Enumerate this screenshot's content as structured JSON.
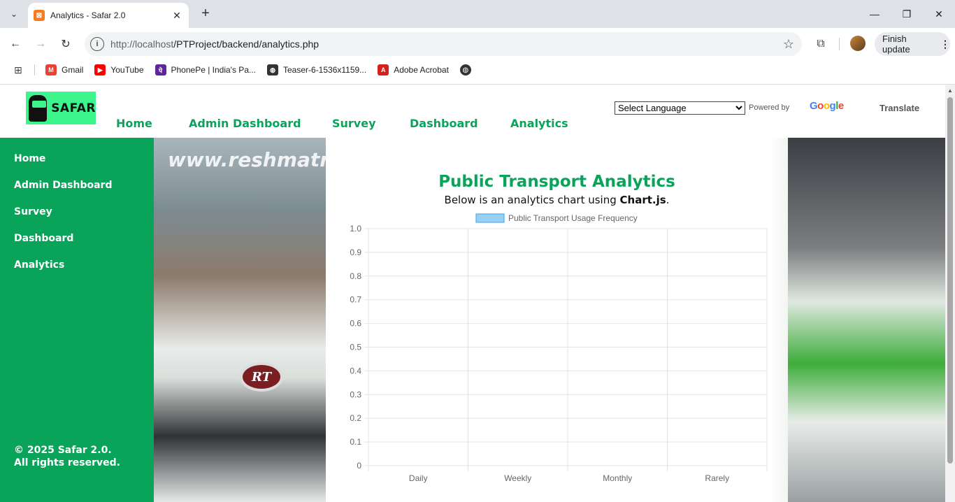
{
  "browser": {
    "tab_title": "Analytics - Safar 2.0",
    "url_host": "http://localhost",
    "url_path": "/PTProject/backend/analytics.php",
    "update_label": "Finish update",
    "bookmarks": [
      {
        "label": "Gmail",
        "color": "#ea4335",
        "glyph": "M"
      },
      {
        "label": "YouTube",
        "color": "#ff0000",
        "glyph": "▶"
      },
      {
        "label": "PhonePe | India's Pa...",
        "color": "#5f259f",
        "glyph": "पे"
      },
      {
        "label": "Teaser-6-1536x1159...",
        "color": "#333333",
        "glyph": "◍"
      },
      {
        "label": "Adobe Acrobat",
        "color": "#d4231c",
        "glyph": "A"
      }
    ]
  },
  "site": {
    "logo_text": "SAFAR",
    "nav": [
      "Home",
      "Admin Dashboard",
      "Survey",
      "Dashboard",
      "Analytics"
    ],
    "language_select": "Select Language",
    "powered_by": "Powered by",
    "google": "Google",
    "translate": "Translate",
    "sidebar": [
      "Home",
      "Admin Dashboard",
      "Survey",
      "Dashboard",
      "Analytics"
    ],
    "footer_line1": "© 2025 Safar 2.0.",
    "footer_line2": "All rights reserved.",
    "background_text": "www.reshmatravels.com",
    "badge_text": "RT"
  },
  "card": {
    "title": "Public Transport Analytics",
    "subtitle_prefix": "Below is an analytics chart using ",
    "subtitle_bold": "Chart.js",
    "subtitle_suffix": "."
  },
  "chart_data": {
    "type": "bar",
    "categories": [
      "Daily",
      "Weekly",
      "Monthly",
      "Rarely"
    ],
    "series": [
      {
        "name": "Public Transport Usage Frequency",
        "values": [
          0,
          0,
          0,
          0
        ]
      }
    ],
    "ylim": [
      0,
      1.0
    ],
    "yticks": [
      "0",
      "0.1",
      "0.2",
      "0.3",
      "0.4",
      "0.5",
      "0.6",
      "0.7",
      "0.8",
      "0.9",
      "1.0"
    ],
    "grid": true,
    "legend_position": "top",
    "series_color": "#9ad0f5",
    "series_border": "#36a2eb"
  }
}
